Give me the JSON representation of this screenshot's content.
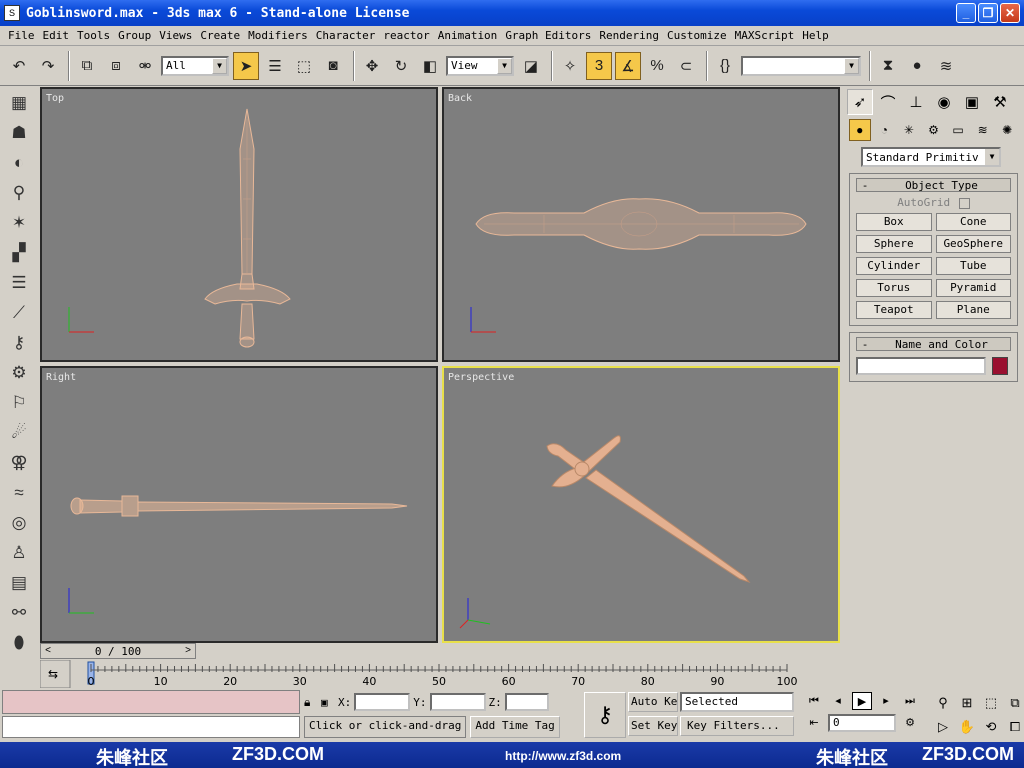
{
  "window": {
    "title": "Goblinsword.max - 3ds max 6 - Stand-alone License",
    "buttons": [
      "_",
      "❐",
      "✕"
    ]
  },
  "menu": [
    "File",
    "Edit",
    "Tools",
    "Group",
    "Views",
    "Create",
    "Modifiers",
    "Character",
    "reactor",
    "Animation",
    "Graph Editors",
    "Rendering",
    "Customize",
    "MAXScript",
    "Help"
  ],
  "toolbar": {
    "selection_filter": "All",
    "reference_coord": "View",
    "named_selection": "",
    "snap_label": "3",
    "icons": [
      "undo-icon",
      "redo-icon",
      "select-link-icon",
      "unlink-icon",
      "bind-space-warp-icon",
      "select-object-icon",
      "select-by-name-icon",
      "rect-region-icon",
      "window-crossing-icon",
      "move-icon",
      "rotate-icon",
      "scale-icon",
      "pivot-icon",
      "manipulate-icon",
      "snap-toggle-icon",
      "angle-snap-icon",
      "percent-snap-icon",
      "spinner-snap-icon",
      "edit-named-selection-icon",
      "mirror-icon",
      "align-icon",
      "layer-manager-icon"
    ]
  },
  "viewports": {
    "top": {
      "label": "Top"
    },
    "back": {
      "label": "Back"
    },
    "right": {
      "label": "Right"
    },
    "perspective": {
      "label": "Perspective"
    }
  },
  "command_panel": {
    "primitive_type": "Standard Primitiv",
    "object_type": {
      "title": "Object Type",
      "autogrid": "AutoGrid",
      "buttons": [
        "Box",
        "Cone",
        "Sphere",
        "GeoSphere",
        "Cylinder",
        "Tube",
        "Torus",
        "Pyramid",
        "Teapot",
        "Plane"
      ]
    },
    "name_color": {
      "title": "Name and Color",
      "value": "",
      "color": "#9a1030"
    }
  },
  "time": {
    "frame_display": "0 / 100",
    "ticks": [
      "0",
      "10",
      "20",
      "30",
      "40",
      "50",
      "60",
      "70",
      "80",
      "90",
      "100"
    ]
  },
  "status": {
    "prompt": "Click or click-and-drag",
    "add_time_tag": "Add Time Tag",
    "x_label": "X:",
    "y_label": "Y:",
    "z_label": "Z:",
    "auto_key": "Auto Key",
    "set_key": "Set Key",
    "selected": "Selected",
    "key_filters": "Key Filters...",
    "current_frame": "0"
  },
  "watermark": {
    "left_brand": "朱峰社区",
    "left_site": "ZF3D.COM",
    "url": "http://www.zf3d.com",
    "right_brand": "朱峰社区",
    "right_site": "ZF3D.COM"
  },
  "colors": {
    "mesh": "#e8b898",
    "viewport_bg": "#7e7e7e",
    "active_border": "#e8e04a",
    "title_bar": "#0a4ad8"
  }
}
